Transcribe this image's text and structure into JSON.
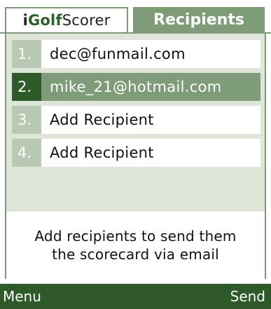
{
  "header": {
    "app_tab": {
      "brand_prefix": "i",
      "brand_golf": "Golf",
      "brand_suffix": "Scorer"
    },
    "active_tab_label": "Recipients"
  },
  "recipients": [
    {
      "number": "1.",
      "label": "dec@funmail.com"
    },
    {
      "number": "2.",
      "label": "mike_21@hotmail.com"
    },
    {
      "number": "3.",
      "label": "Add Recipient"
    },
    {
      "number": "4.",
      "label": "Add Recipient"
    }
  ],
  "help": {
    "line1": "Add recipients to send them",
    "line2": "the scorecard via email"
  },
  "softkeys": {
    "left": "Menu",
    "right": "Send"
  },
  "colors": {
    "brand_dark_green": "#2d5a28",
    "tab_green": "#7d9c77",
    "panel_background": "#dde6d8",
    "number_cell": "#b9c9b3"
  }
}
